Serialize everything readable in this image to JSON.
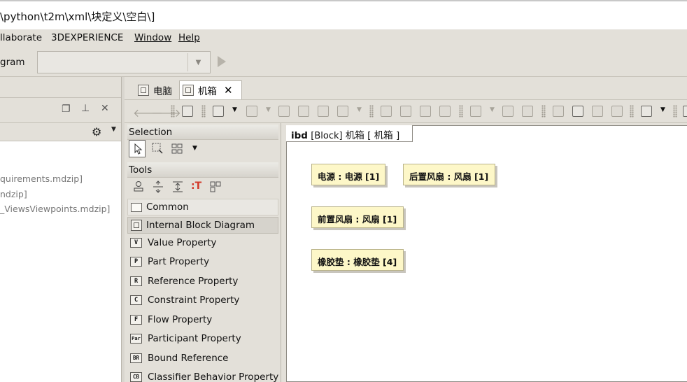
{
  "window": {
    "title": "\\python\\t2m\\xml\\块定义\\空白\\]"
  },
  "menu": {
    "collaborate": "llaborate",
    "experience": "3DEXPERIENCE",
    "window": "Window",
    "help": "Help"
  },
  "toolbar": {
    "diagram_label": "gram",
    "diagram_combo_value": ""
  },
  "left_panel": {
    "items": [
      "quirements.mdzip]",
      "ndzip]",
      "_ViewsViewpoints.mdzip]"
    ]
  },
  "tabs": [
    {
      "label": "电脑",
      "active": false
    },
    {
      "label": "机箱",
      "active": true
    }
  ],
  "palette": {
    "selection_header": "Selection",
    "tools_header": "Tools",
    "groups": {
      "common": "Common",
      "ibd": "Internal Block Diagram"
    },
    "items": [
      {
        "icon_text": "V",
        "label": "Value Property"
      },
      {
        "icon_text": "P",
        "label": "Part Property"
      },
      {
        "icon_text": "R",
        "label": "Reference Property"
      },
      {
        "icon_text": "C",
        "label": "Constraint Property"
      },
      {
        "icon_text": "F",
        "label": "Flow Property"
      },
      {
        "icon_text": "Par",
        "label": "Participant Property"
      },
      {
        "icon_text": "BR",
        "label": "Bound Reference"
      },
      {
        "icon_text": "CB",
        "label": "Classifier Behavior Property"
      }
    ]
  },
  "diagram": {
    "frame_kind": "ibd",
    "frame_stereotype": "[Block]",
    "frame_name": "机箱 [ 机箱 ]",
    "parts": [
      {
        "label": "电源 : 电源 [1]"
      },
      {
        "label": "后置风扇 : 风扇 [1]"
      },
      {
        "label": "前置风扇 : 风扇 [1]"
      },
      {
        "label": "橡胶垫 : 橡胶垫 [4]"
      }
    ]
  }
}
